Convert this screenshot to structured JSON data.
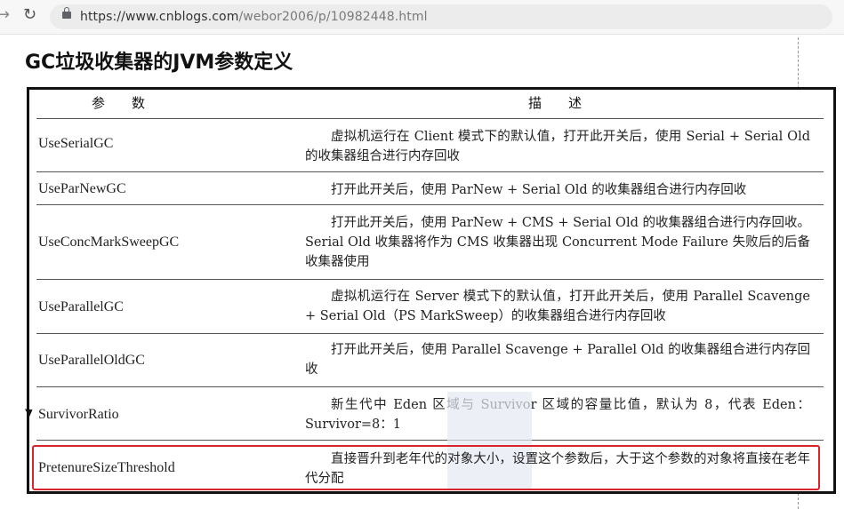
{
  "browser": {
    "url_host": "https://www.cnblogs.com",
    "url_path": "/webor2006/p/10982448.html"
  },
  "page": {
    "title": "GC垃圾收集器的JVM参数定义"
  },
  "table": {
    "headers": [
      "参　　数",
      "描　　述"
    ],
    "rows": [
      {
        "name": "UseSerialGC",
        "desc": "虚拟机运行在 Client 模式下的默认值，打开此开关后，使用 Serial + Serial Old 的收集器组合进行内存回收"
      },
      {
        "name": "UseParNewGC",
        "desc": "打开此开关后，使用 ParNew + Serial Old 的收集器组合进行内存回收"
      },
      {
        "name": "UseConcMarkSweepGC",
        "desc": "打开此开关后，使用 ParNew + CMS + Serial Old 的收集器组合进行内存回收。Serial Old 收集器将作为 CMS 收集器出现 Concurrent Mode Failure 失败后的后备收集器使用"
      },
      {
        "name": "UseParallelGC",
        "desc": "虚拟机运行在 Server 模式下的默认值，打开此开关后，使用 Parallel Scavenge + Serial Old（PS MarkSweep）的收集器组合进行内存回收"
      },
      {
        "name": "UseParallelOldGC",
        "desc": "打开此开关后，使用 Parallel Scavenge + Parallel Old 的收集器组合进行内存回收"
      },
      {
        "name": "SurvivorRatio",
        "desc": "新生代中 Eden 区域与 Survivor 区域的容量比值，默认为 8，代表 Eden：Survivor=8：1"
      },
      {
        "name": "PretenureSizeThreshold",
        "desc": "直接晋升到老年代的对象大小，设置这个参数后，大于这个参数的对象将直接在老年代分配"
      }
    ]
  }
}
